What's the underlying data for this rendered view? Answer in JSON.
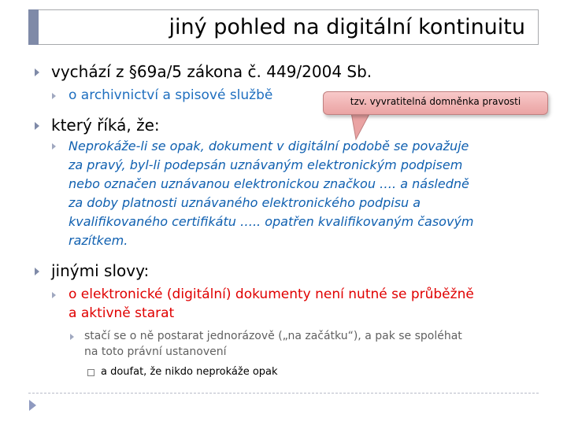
{
  "slide": {
    "title": "jiný pohled na digitální kontinuitu"
  },
  "bullets": {
    "b1": "vychází z §69a/5 zákona č. 449/2004 Sb.",
    "b1_sub": "o archivnictví a spisové službě",
    "b2": "který říká, že:",
    "b2_sub_lines": [
      "Neprokáže-li se opak, dokument v digitální podobě se považuje",
      "za pravý, byl-li podepsán uznávaným elektronickým podpisem",
      "nebo označen uznávanou elektronickou značkou …. a následně",
      "za doby platnosti uznávaného elektronického podpisu a",
      "kvalifikovaného certifikátu ….. opatřen kvalifikovaným časovým",
      "razítkem."
    ],
    "b3": "jinými slovy:",
    "b3_sub_lines": [
      "o elektronické (digitální) dokumenty není nutné se průběžně",
      "a aktivně starat"
    ],
    "b3_sub_sub_lines": [
      "stačí se o ně postarat jednorázově („na začátku“), a pak se spoléhat",
      "na toto právní ustanovení"
    ],
    "b3_sub_sub_sub": "a doufat, že nikdo neprokáže opak"
  },
  "callout": {
    "text": "tzv. vyvratitelná domněnka pravosti"
  },
  "colors": {
    "accent": "#7f8aa8",
    "blue_text": "#1f6fbf",
    "red_text": "#e00000",
    "callout_fill": "#f4b8b8"
  }
}
